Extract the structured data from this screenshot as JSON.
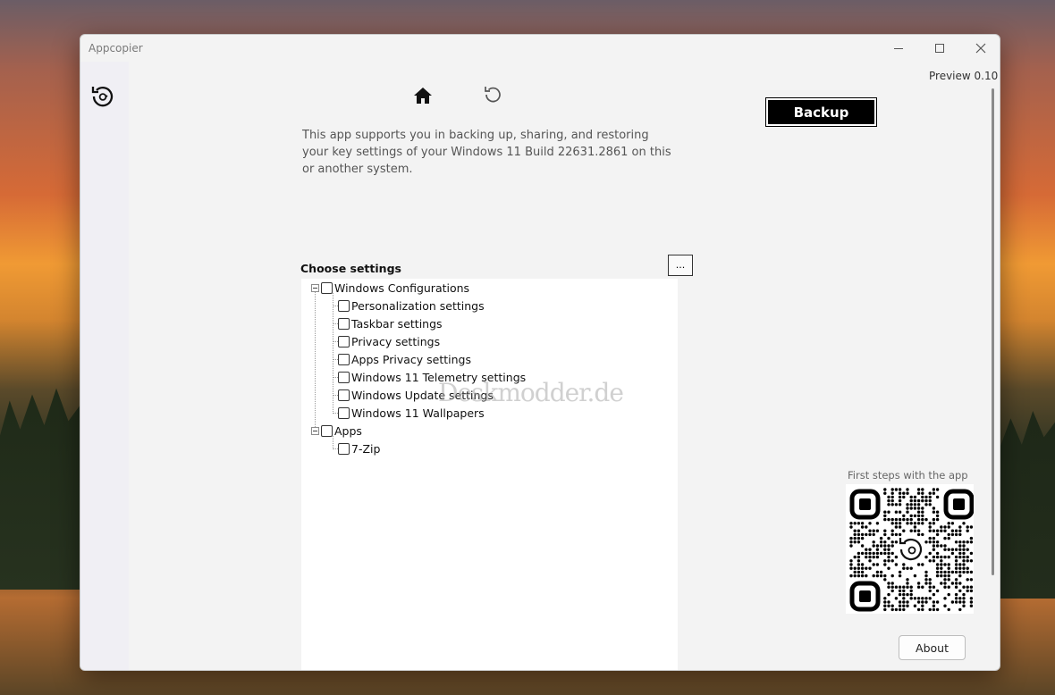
{
  "window": {
    "title": "Appcopier",
    "preview_label": "Preview 0.10"
  },
  "main": {
    "description": "This app supports you in backing up, sharing, and restoring your key settings of your Windows 11 Build 22631.2861 on this or another system.",
    "backup_label": "Backup",
    "choose_label": "Choose settings",
    "more_label": "...",
    "about_label": "About",
    "qr_caption": "First steps with the app",
    "watermark": "Deskmodder.de"
  },
  "tree": {
    "groups": [
      {
        "label": "Windows Configurations",
        "items": [
          "Personalization settings",
          "Taskbar settings",
          "Privacy settings",
          "Apps Privacy settings",
          "Windows 11 Telemetry settings",
          "Windows Update settings",
          "Windows 11 Wallpapers"
        ]
      },
      {
        "label": "Apps",
        "items": [
          "7-Zip"
        ]
      }
    ]
  },
  "icons": {
    "rail": "restore-icon",
    "home": "home-icon",
    "restore": "restore-icon"
  }
}
